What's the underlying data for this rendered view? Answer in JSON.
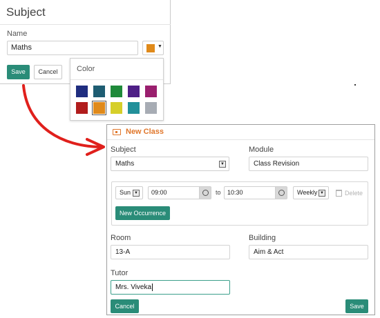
{
  "subject_form": {
    "title": "Subject",
    "name_label": "Name",
    "name_value": "Maths",
    "selected_color": "#e08a1a",
    "save_label": "Save",
    "cancel_label": "Cancel"
  },
  "color_popup": {
    "title": "Color",
    "swatches": [
      "#1f2d7f",
      "#1e5d72",
      "#1f8a3a",
      "#4e1f86",
      "#9a1f6e",
      "#b11d1d",
      "#e08a1a",
      "#d6cf2a",
      "#22909a",
      "#a7acb4"
    ],
    "selected_color": "#e08a1a"
  },
  "new_class": {
    "header_icon": "classroom-icon",
    "title": "New Class",
    "subject_label": "Subject",
    "subject_value": "Maths",
    "module_label": "Module",
    "module_value": "Class Revision",
    "occurrence": {
      "day": "Sun",
      "start_time": "09:00",
      "to_label": "to",
      "end_time": "10:30",
      "frequency": "Weekly",
      "delete_label": "Delete",
      "new_occurrence_label": "New Occurrence"
    },
    "room_label": "Room",
    "room_value": "13-A",
    "building_label": "Building",
    "building_value": "Aim & Act",
    "tutor_label": "Tutor",
    "tutor_value": "Mrs. Viveka",
    "cancel_label": "Cancel",
    "save_label": "Save"
  },
  "colors": {
    "accent": "#2a8c78",
    "header_orange": "#e0762a",
    "arrow": "#e0201c"
  }
}
